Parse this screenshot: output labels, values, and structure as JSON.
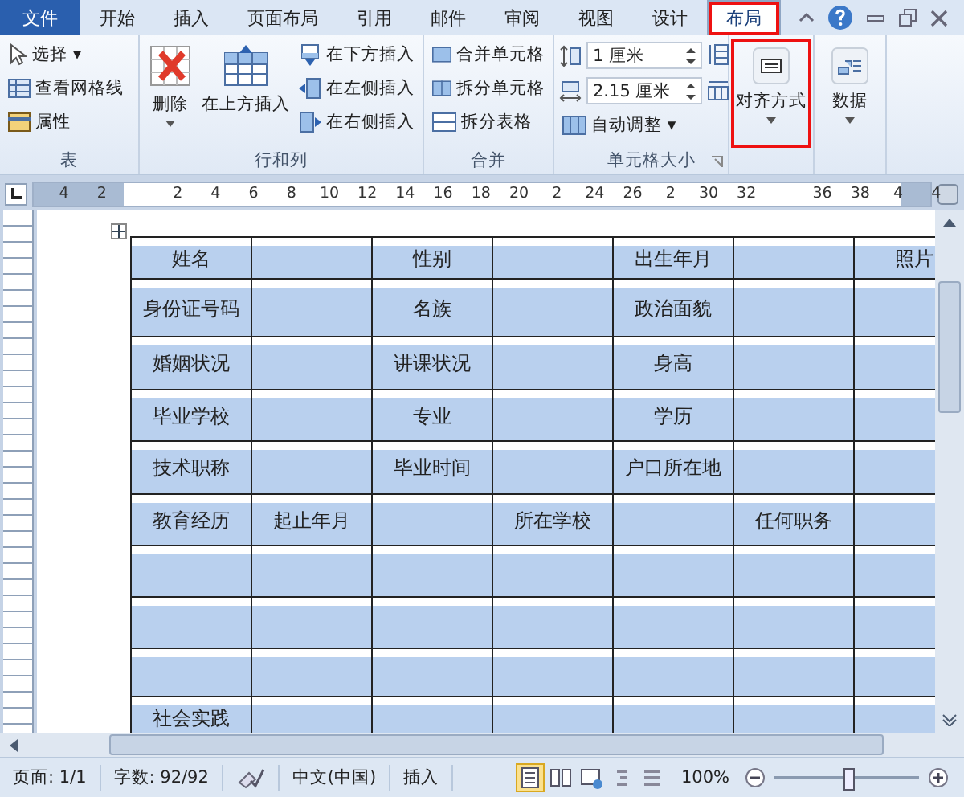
{
  "tabs": [
    {
      "label": "文件",
      "kind": "file",
      "selected": false,
      "highlighted": false
    },
    {
      "label": "开始",
      "kind": "tab",
      "selected": false,
      "highlighted": false
    },
    {
      "label": "插入",
      "kind": "tab",
      "selected": false,
      "highlighted": false
    },
    {
      "label": "页面布局",
      "kind": "tab",
      "selected": false,
      "highlighted": false
    },
    {
      "label": "引用",
      "kind": "tab",
      "selected": false,
      "highlighted": false
    },
    {
      "label": "邮件",
      "kind": "tab",
      "selected": false,
      "highlighted": false
    },
    {
      "label": "审阅",
      "kind": "tab",
      "selected": false,
      "highlighted": false
    },
    {
      "label": "视图",
      "kind": "tab",
      "selected": false,
      "highlighted": false
    },
    {
      "label": "设计",
      "kind": "tab",
      "selected": false,
      "highlighted": false
    },
    {
      "label": "布局",
      "kind": "tab",
      "selected": true,
      "highlighted": true
    }
  ],
  "ribbon": {
    "table_group": {
      "label": "表",
      "items": [
        "选择",
        "查看网格线",
        "属性"
      ],
      "dropdown": "▾"
    },
    "rows_cols_group": {
      "label": "行和列",
      "delete": "删除",
      "insert_above": "在上方插入",
      "items": [
        "在下方插入",
        "在左侧插入",
        "在右侧插入"
      ]
    },
    "merge_group": {
      "label": "合并",
      "items": [
        "合并单元格",
        "拆分单元格",
        "拆分表格"
      ]
    },
    "cell_size_group": {
      "label": "单元格大小",
      "height": "1 厘米",
      "width": "2.15 厘米",
      "autofit": "自动调整"
    },
    "alignment": {
      "label": "对齐方式",
      "highlighted": true
    },
    "data": {
      "label": "数据"
    }
  },
  "ruler": [
    "4",
    "2",
    "2",
    "4",
    "6",
    "8",
    "10",
    "12",
    "14",
    "16",
    "18",
    "20",
    "2",
    "24",
    "26",
    "2",
    "30",
    "32",
    "36",
    "38",
    "4",
    "4"
  ],
  "table": {
    "rows": [
      [
        "姓名",
        null,
        "性别",
        null,
        "出生年月",
        null,
        "照片"
      ],
      [
        "身份证号码",
        null,
        "名族",
        null,
        "政治面貌",
        null,
        null
      ],
      [
        "婚姻状况",
        null,
        "讲课状况",
        null,
        "身高",
        null,
        null
      ],
      [
        "毕业学校",
        null,
        "专业",
        null,
        "学历",
        null,
        null
      ],
      [
        "技术职称",
        null,
        "毕业时间",
        null,
        "户口所在地",
        null,
        null
      ],
      [
        "教育经历",
        "起止年月",
        null,
        "所在学校",
        null,
        "任何职务",
        null
      ],
      [
        null,
        null,
        null,
        null,
        null,
        null,
        null
      ],
      [
        null,
        null,
        null,
        null,
        null,
        null,
        null
      ],
      [
        null,
        null,
        null,
        null,
        null,
        null,
        null
      ],
      [
        "社会实践",
        null,
        null,
        null,
        null,
        null,
        null
      ]
    ]
  },
  "status_bar": {
    "page": "页面: 1/1",
    "words": "字数: 92/92",
    "language": "中文(中国)",
    "mode": "插入",
    "zoom": "100%"
  }
}
